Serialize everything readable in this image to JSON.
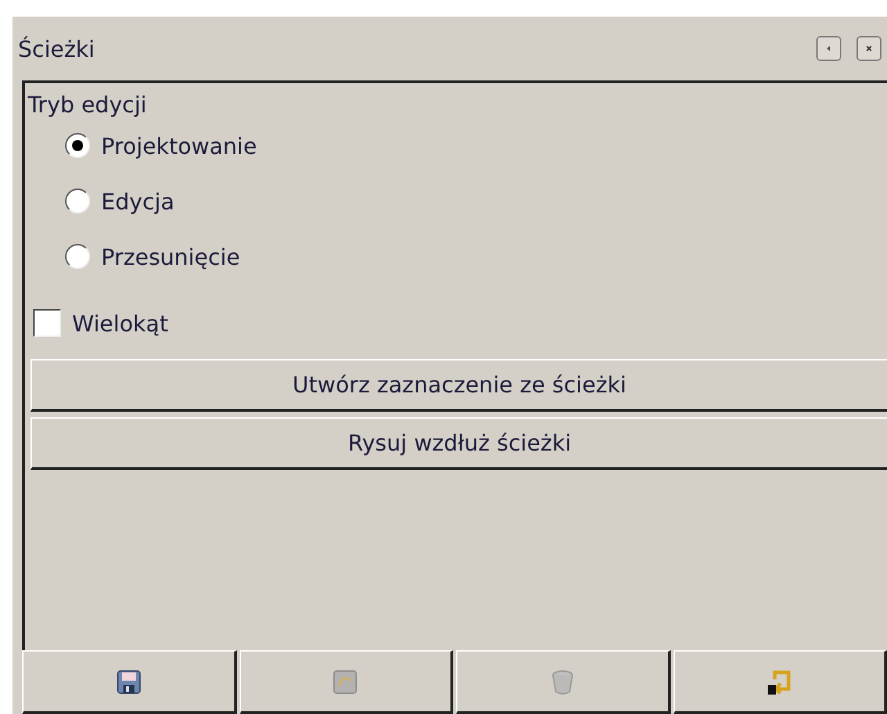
{
  "panel": {
    "title": "Ścieżki"
  },
  "edit_mode": {
    "label": "Tryb edycji",
    "options": [
      {
        "label": "Projektowanie",
        "selected": true
      },
      {
        "label": "Edycja",
        "selected": false
      },
      {
        "label": "Przesunięcie",
        "selected": false
      }
    ]
  },
  "polygon": {
    "label": "Wielokąt",
    "checked": false
  },
  "actions": [
    "Utwórz zaznaczenie ze ścieżki",
    "Rysuj wzdłuż ścieżki"
  ],
  "toolbar": [
    {
      "kind": "save",
      "disabled": false
    },
    {
      "kind": "import",
      "disabled": true
    },
    {
      "kind": "delete",
      "disabled": true
    },
    {
      "kind": "export",
      "disabled": false
    }
  ]
}
